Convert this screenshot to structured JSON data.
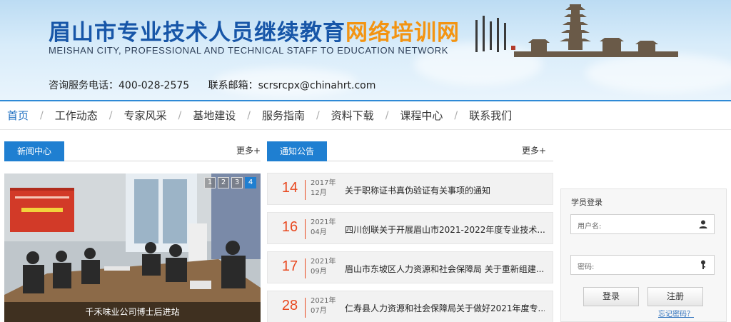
{
  "header": {
    "title_blue": "眉山市专业技术人员继续教育",
    "title_orange": "网络培训网",
    "title_en": "MEISHAN CITY, PROFESSIONAL AND TECHNICAL STAFF TO EDUCATION NETWORK",
    "phone": "咨询服务电话：400-028-2575",
    "email": "联系邮箱：scrsrcpx@chinahrt.com"
  },
  "nav": {
    "items": [
      "首页",
      "工作动态",
      "专家风采",
      "基地建设",
      "服务指南",
      "资料下载",
      "课程中心",
      "联系我们"
    ]
  },
  "news": {
    "tab": "新闻中心",
    "more": "更多+",
    "pager": [
      "1",
      "2",
      "3",
      "4"
    ],
    "caption": "千禾味业公司博士后进站"
  },
  "notices": {
    "tab": "通知公告",
    "more": "更多+",
    "items": [
      {
        "day": "14",
        "year": "2017年",
        "month": "12月",
        "title": "关于职称证书真伪验证有关事项的通知"
      },
      {
        "day": "16",
        "year": "2021年",
        "month": "04月",
        "title": "四川创联关于开展眉山市2021-2022年度专业技术..."
      },
      {
        "day": "17",
        "year": "2021年",
        "month": "09月",
        "title": "眉山市东坡区人力资源和社会保障局 关于重新组建..."
      },
      {
        "day": "28",
        "year": "2021年",
        "month": "07月",
        "title": "仁寿县人力资源和社会保障局关于做好2021年度专..."
      }
    ]
  },
  "login": {
    "title": "学员登录",
    "username_placeholder": "用户名:",
    "password_placeholder": "密码:",
    "login_label": "登录",
    "register_label": "注册",
    "forgot_label": "忘记密码？"
  },
  "colors": {
    "accent": "#1f7fd1",
    "title_blue": "#1756a8",
    "title_orange": "#f39412",
    "date_red": "#e8481f"
  }
}
